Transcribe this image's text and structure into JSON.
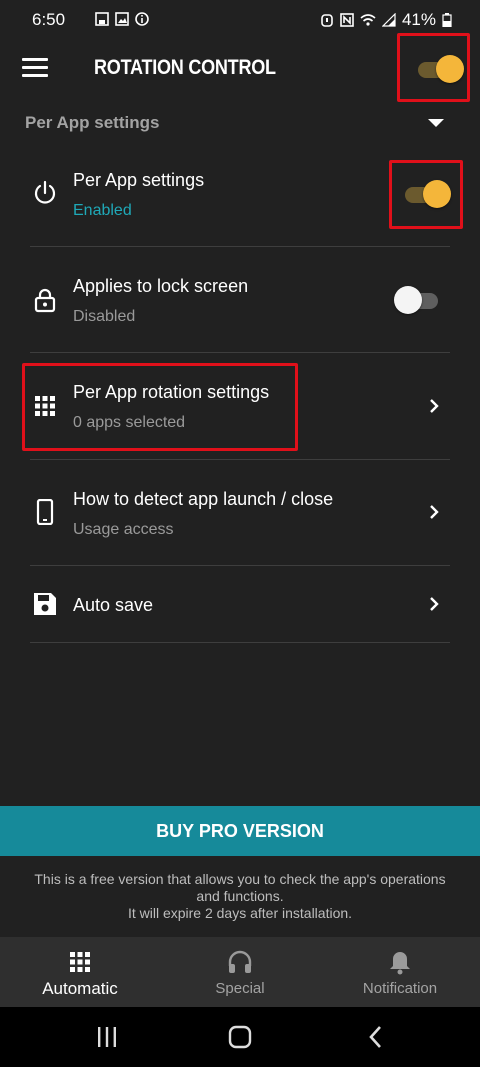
{
  "status_bar": {
    "time": "6:50",
    "battery": "41%"
  },
  "toolbar": {
    "title": "ROTATION CONTROL",
    "master_switch_on": true
  },
  "section": {
    "title": "Per App settings"
  },
  "rows": [
    {
      "title": "Per App settings",
      "subtitle": "Enabled",
      "icon": "power-icon",
      "control": "switch",
      "on": true
    },
    {
      "title": "Applies to lock screen",
      "subtitle": "Disabled",
      "icon": "lock-icon",
      "control": "switch",
      "on": false
    },
    {
      "title": "Per App rotation settings",
      "subtitle": "0 apps selected",
      "icon": "apps-grid-icon",
      "control": "chevron"
    },
    {
      "title": "How to detect app launch / close",
      "subtitle": "Usage access",
      "icon": "phone-icon",
      "control": "chevron"
    },
    {
      "title": "Auto save",
      "subtitle": "",
      "icon": "save-icon",
      "control": "chevron"
    }
  ],
  "buy_pro": {
    "label": "BUY PRO VERSION"
  },
  "free_note": {
    "line1": "This is a free version that allows you to check the app's operations",
    "line2": "and functions.",
    "line3": "It will expire 2 days after installation."
  },
  "bottom_nav": {
    "tabs": [
      {
        "label": "Automatic",
        "icon": "apps-grid-icon",
        "active": true
      },
      {
        "label": "Special",
        "icon": "headphones-icon",
        "active": false
      },
      {
        "label": "Notification",
        "icon": "bell-icon",
        "active": false
      }
    ]
  },
  "colors": {
    "background": "#212121",
    "accent_teal": "#168a9a",
    "switch_on": "#f4b63a",
    "highlight_red": "#e0101a"
  }
}
